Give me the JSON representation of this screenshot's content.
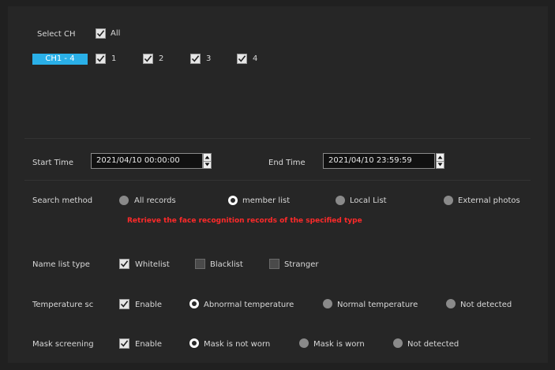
{
  "channels": {
    "select_label": "Select CH",
    "all_label": "All",
    "all_checked": true,
    "group_tab": "CH1 - 4",
    "items": [
      {
        "label": "1",
        "checked": true
      },
      {
        "label": "2",
        "checked": true
      },
      {
        "label": "3",
        "checked": true
      },
      {
        "label": "4",
        "checked": true
      }
    ]
  },
  "time": {
    "start_label": "Start Time",
    "start_value": "2021/04/10 00:00:00",
    "end_label": "End Time",
    "end_value": "2021/04/10 23:59:59"
  },
  "search": {
    "label": "Search method",
    "options": [
      {
        "label": "All records",
        "selected": false
      },
      {
        "label": "member list",
        "selected": true
      },
      {
        "label": "Local List",
        "selected": false
      },
      {
        "label": "External photos",
        "selected": false
      }
    ],
    "hint": "Retrieve the face recognition records of the specified type",
    "hint_color": "#ff2a2a"
  },
  "name_list": {
    "label": "Name list type",
    "options": [
      {
        "label": "Whitelist",
        "checked": true
      },
      {
        "label": "Blacklist",
        "checked": false
      },
      {
        "label": "Stranger",
        "checked": false
      }
    ]
  },
  "temperature": {
    "label": "Temperature sc",
    "enable_label": "Enable",
    "enabled": true,
    "options": [
      {
        "label": "Abnormal temperature",
        "selected": true
      },
      {
        "label": "Normal temperature",
        "selected": false
      },
      {
        "label": "Not detected",
        "selected": false
      }
    ]
  },
  "mask": {
    "label": "Mask screening",
    "enable_label": "Enable",
    "enabled": true,
    "options": [
      {
        "label": "Mask is not worn",
        "selected": true
      },
      {
        "label": "Mask is worn",
        "selected": false
      },
      {
        "label": "Not detected",
        "selected": false
      }
    ]
  },
  "colors": {
    "background": "#262626",
    "accent": "#2ab0e8",
    "text": "#d8d8d8"
  }
}
